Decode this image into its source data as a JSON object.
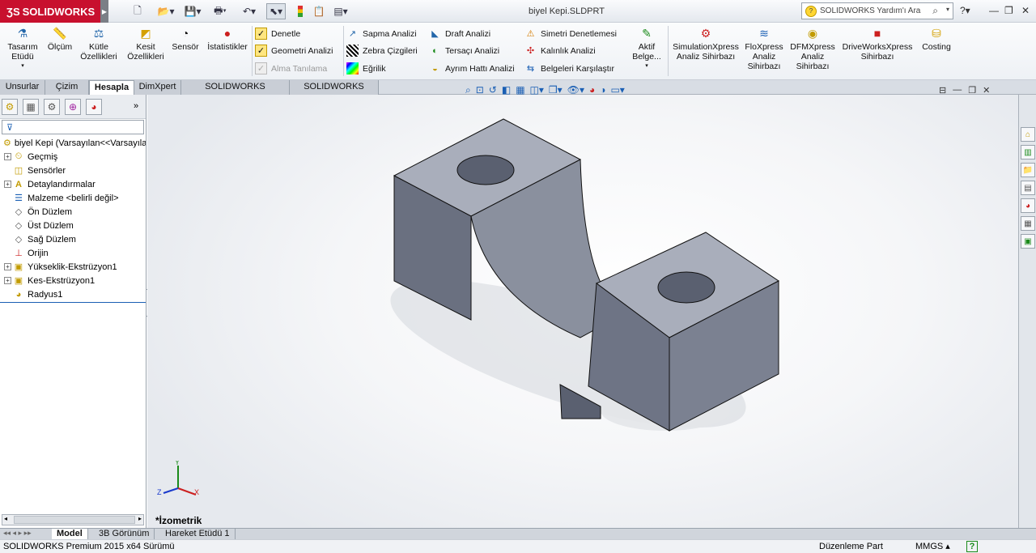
{
  "app": {
    "logo_text": "SOLIDWORKS",
    "document_title": "biyel Kepi.SLDPRT"
  },
  "search": {
    "placeholder": "SOLIDWORKS Yardım'ı Ara"
  },
  "ribbon": {
    "big_buttons": [
      {
        "label": "Tasarım Etüdü",
        "icon": "design-study-icon"
      },
      {
        "label": "Ölçüm",
        "icon": "measure-icon"
      },
      {
        "label": "Kütle Özellikleri",
        "icon": "mass-properties-icon"
      },
      {
        "label": "Kesit Özellikleri",
        "icon": "section-properties-icon"
      },
      {
        "label": "Sensör",
        "icon": "sensor-icon"
      },
      {
        "label": "İstatistikler",
        "icon": "statistics-icon"
      }
    ],
    "col1": [
      {
        "label": "Denetle",
        "icon": "check-icon"
      },
      {
        "label": "Geometri Analizi",
        "icon": "geometry-analysis-icon"
      },
      {
        "label": "Alma Tanılama",
        "icon": "import-diagnostics-icon"
      }
    ],
    "col2": [
      {
        "label": "Sapma Analizi",
        "icon": "deviation-analysis-icon"
      },
      {
        "label": "Zebra Çizgileri",
        "icon": "zebra-stripes-icon"
      },
      {
        "label": "Eğrilik",
        "icon": "curvature-icon"
      }
    ],
    "col3": [
      {
        "label": "Draft Analizi",
        "icon": "draft-analysis-icon"
      },
      {
        "label": "Tersaçı Analizi",
        "icon": "undercut-analysis-icon"
      },
      {
        "label": "Ayrım Hattı Analizi",
        "icon": "parting-line-icon"
      }
    ],
    "col4": [
      {
        "label": "Simetri Denetlemesi",
        "icon": "symmetry-check-icon"
      },
      {
        "label": "Kalınlık Analizi",
        "icon": "thickness-analysis-icon"
      },
      {
        "label": "Belgeleri  Karşılaştır",
        "icon": "compare-documents-icon"
      }
    ],
    "active_label": "Aktif Belge...",
    "xpress": [
      {
        "label": "SimulationXpress Analiz Sihirbazı",
        "icon": "simulationxpress-icon"
      },
      {
        "label": "FloXpress Analiz Sihirbazı",
        "icon": "floxpress-icon"
      },
      {
        "label": "DFMXpress Analiz Sihirbazı",
        "icon": "dfmxpress-icon"
      },
      {
        "label": "DriveWorksXpress Sihirbazı",
        "icon": "driveworksxpress-icon"
      },
      {
        "label": "Costing",
        "icon": "costing-icon"
      }
    ]
  },
  "command_tabs": [
    "Unsurlar",
    "Çizim",
    "Hesapla",
    "DimXpert",
    "SOLIDWORKS Eklentileri",
    "SOLIDWORKS MBD"
  ],
  "active_tab": "Hesapla",
  "feature_tree": {
    "filter_icon": "filter-icon",
    "root": "biyel Kepi  (Varsayılan<<Varsayılan>",
    "items": [
      {
        "label": "Geçmiş",
        "expandable": true,
        "icon": "history-icon"
      },
      {
        "label": "Sensörler",
        "expandable": false,
        "icon": "sensors-icon"
      },
      {
        "label": "Detaylandırmalar",
        "expandable": true,
        "icon": "annotations-icon"
      },
      {
        "label": "Malzeme <belirli değil>",
        "expandable": false,
        "icon": "material-icon"
      },
      {
        "label": "Ön Düzlem",
        "expandable": false,
        "icon": "plane-icon"
      },
      {
        "label": "Üst Düzlem",
        "expandable": false,
        "icon": "plane-icon"
      },
      {
        "label": "Sağ Düzlem",
        "expandable": false,
        "icon": "plane-icon"
      },
      {
        "label": "Orijin",
        "expandable": false,
        "icon": "origin-icon"
      },
      {
        "label": "Yükseklik-Ekstrüzyon1",
        "expandable": true,
        "icon": "extrude-icon"
      },
      {
        "label": "Kes-Ekstrüzyon1",
        "expandable": true,
        "icon": "cut-extrude-icon"
      },
      {
        "label": "Radyus1",
        "expandable": false,
        "icon": "fillet-icon"
      }
    ]
  },
  "viewport": {
    "view_name": "*İzometrik"
  },
  "bottom_tabs": [
    "Model",
    "3B Görünüm",
    "Hareket Etüdü 1"
  ],
  "active_bottom_tab": "Model",
  "status": {
    "edition": "SOLIDWORKS Premium 2015 x64 Sürümü",
    "mode": "Düzenleme Part",
    "units": "MMGS",
    "help_icon": "?"
  },
  "colors": {
    "brand": "#c8102e",
    "part": "#6e7585",
    "accent": "#1a5fb4"
  }
}
